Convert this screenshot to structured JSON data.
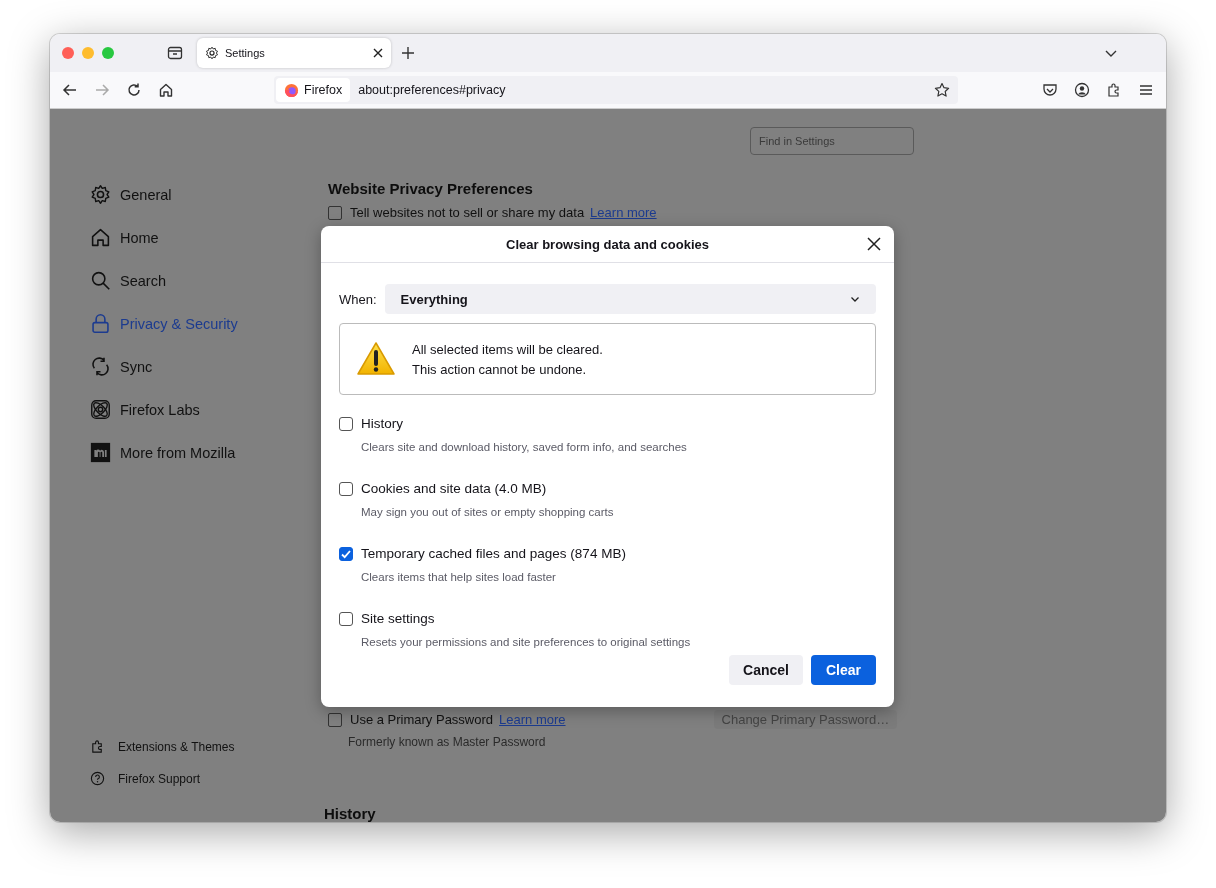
{
  "window": {
    "tabs": [
      {
        "label": "Settings",
        "selected": true
      }
    ],
    "identity": "Firefox",
    "url": "about:preferences#privacy"
  },
  "sidebar": {
    "items": [
      {
        "label": "General",
        "selected": false
      },
      {
        "label": "Home",
        "selected": false
      },
      {
        "label": "Search",
        "selected": false
      },
      {
        "label": "Privacy & Security",
        "selected": true
      },
      {
        "label": "Sync",
        "selected": false
      },
      {
        "label": "Firefox Labs",
        "selected": false
      },
      {
        "label": "More from Mozilla",
        "selected": false
      }
    ],
    "footer_items": [
      "Extensions & Themes",
      "Firefox Support"
    ]
  },
  "page": {
    "search": {
      "placeholder": "Find in Settings"
    },
    "section_title": "Website Privacy Preferences",
    "privacy_option": {
      "label": "Tell websites not to sell or share my data",
      "checked": false,
      "link": "Learn more"
    },
    "password_option": {
      "label": "Use a Primary Password",
      "checked": false,
      "link": "Learn more",
      "hint": "Formerly known as Master Password",
      "button": "Change Primary Password…"
    },
    "next_section": "History"
  },
  "dialog": {
    "title": "Clear browsing data and cookies",
    "when_label": "When:",
    "when_value": "Everything",
    "warning": [
      "All selected items will be cleared.",
      "This action cannot be undone."
    ],
    "options": [
      {
        "label": "History",
        "description": "Clears site and download history, saved form info, and searches",
        "checked": false
      },
      {
        "label": "Cookies and site data (4.0 MB)",
        "description": "May sign you out of sites or empty shopping carts",
        "checked": false
      },
      {
        "label": "Temporary cached files and pages (874 MB)",
        "description": "Clears items that help sites load faster",
        "checked": true
      },
      {
        "label": "Site settings",
        "description": "Resets your permissions and site preferences to original settings",
        "checked": false
      }
    ],
    "buttons": [
      {
        "label": "Cancel",
        "kind": "secondary"
      },
      {
        "label": "Clear",
        "kind": "primary"
      }
    ]
  }
}
